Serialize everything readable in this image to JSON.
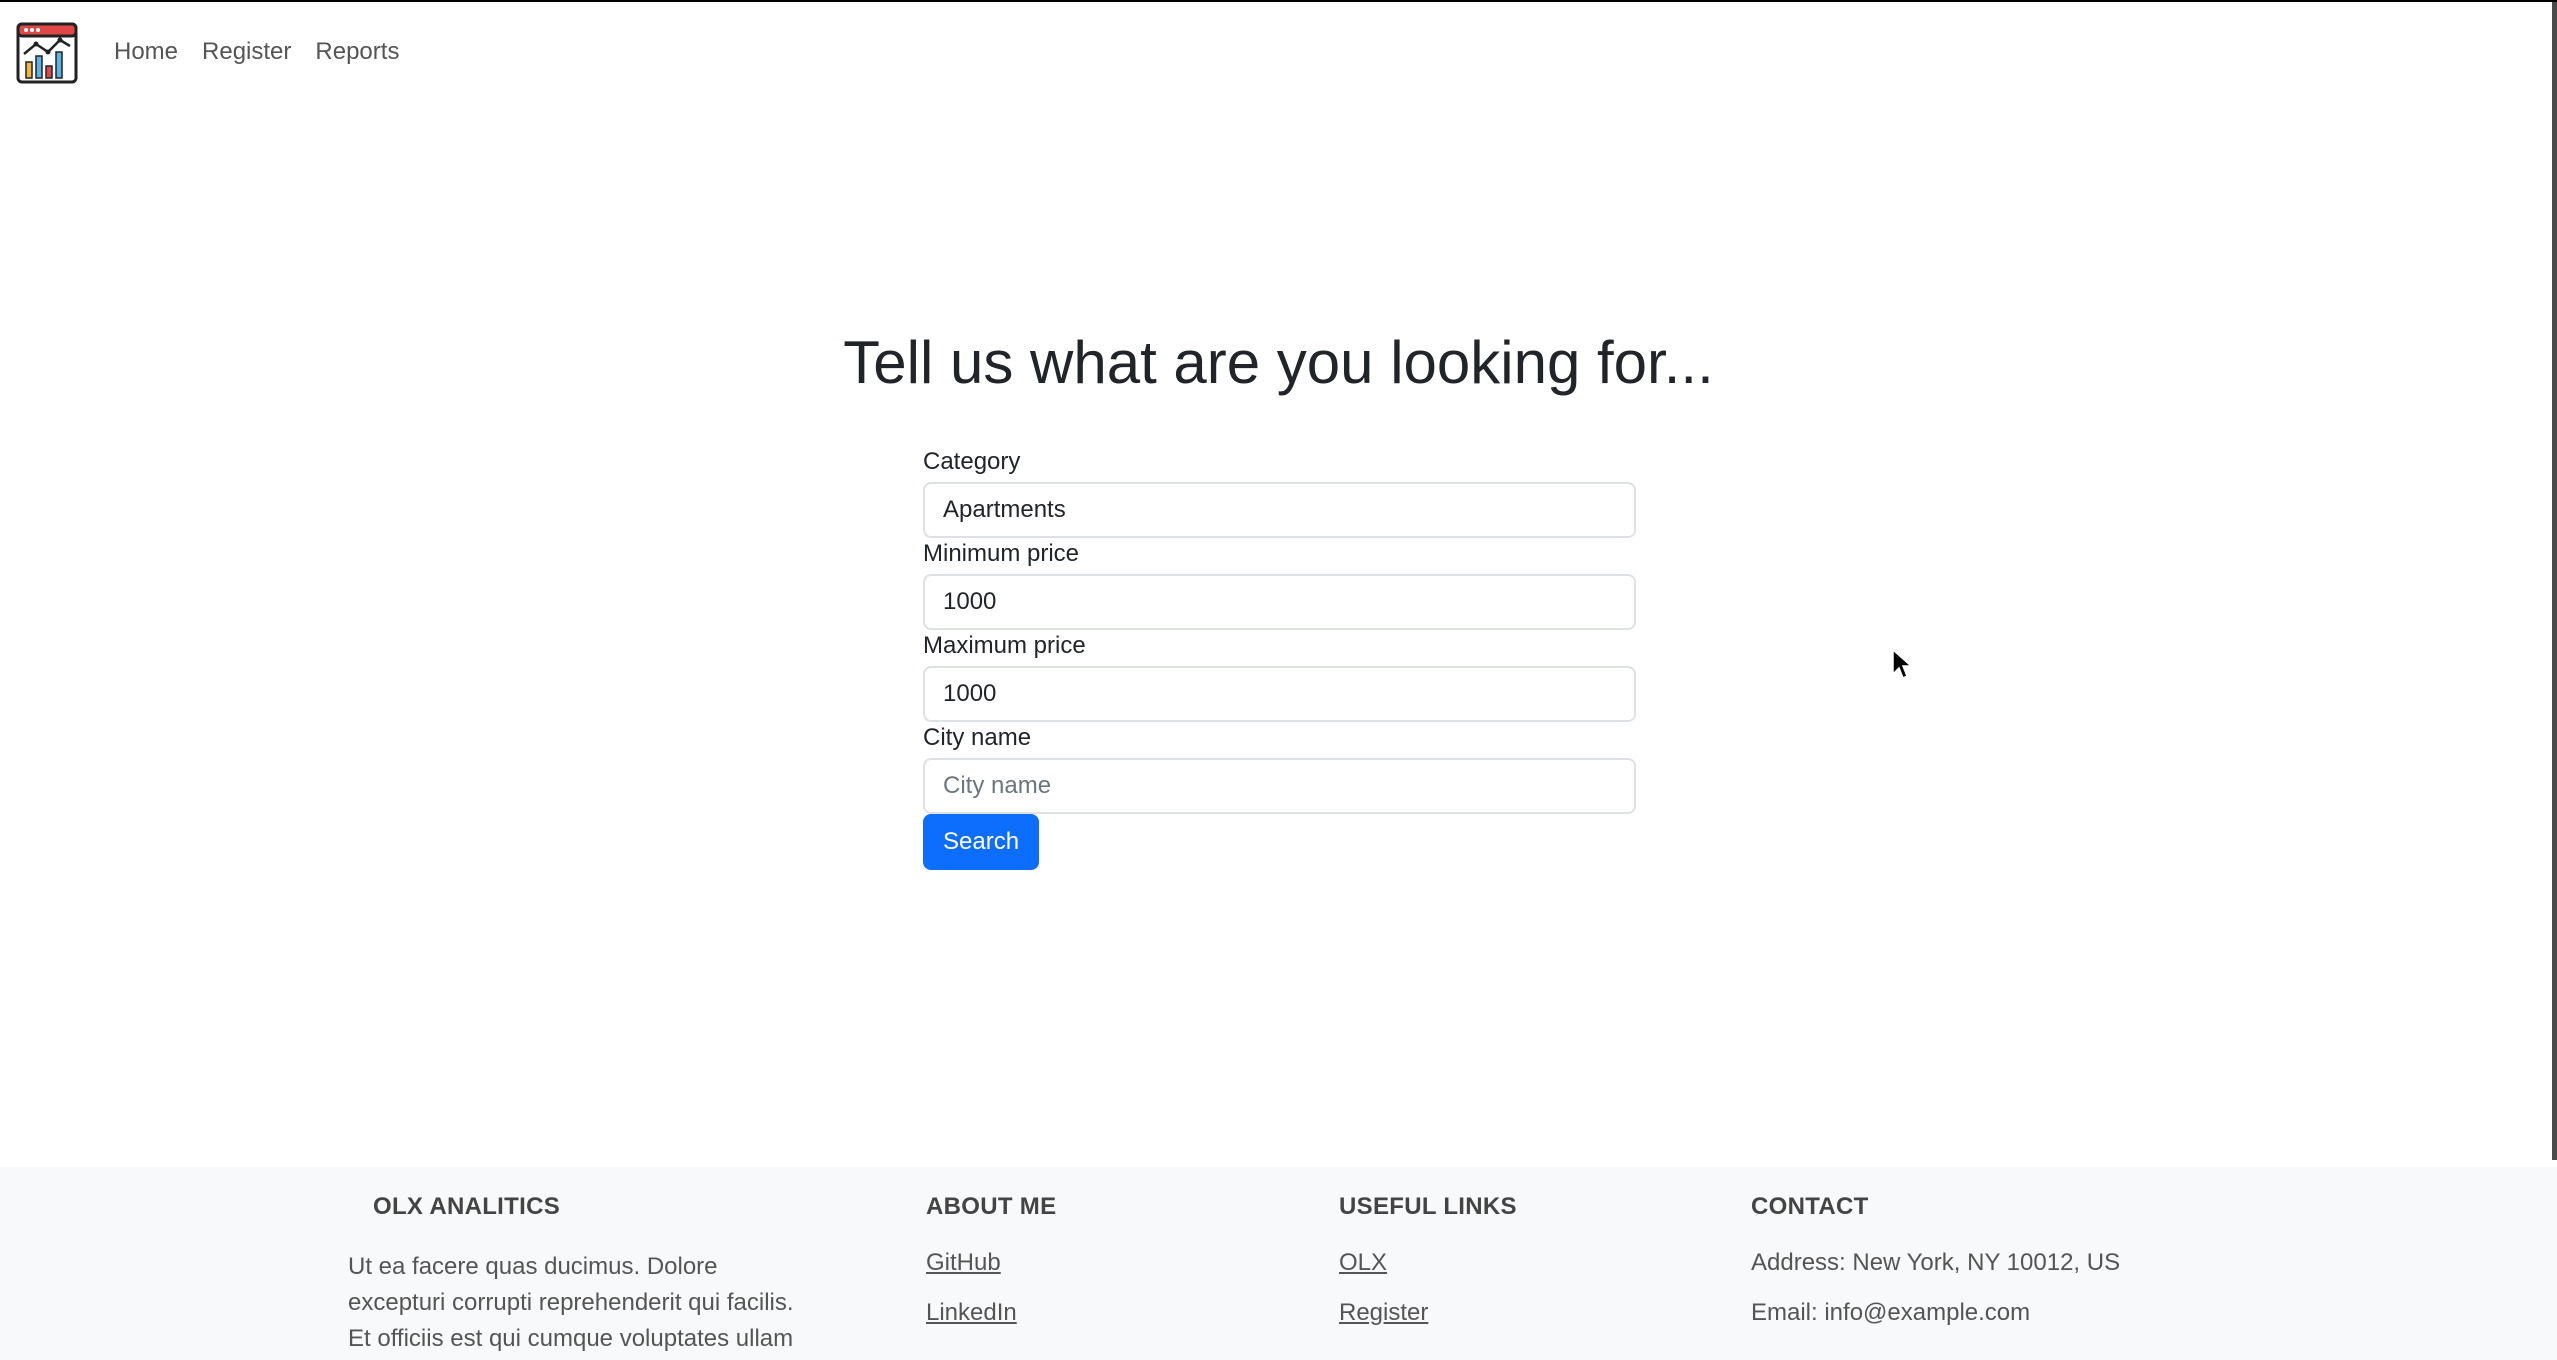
{
  "navbar": {
    "logo_icon": "analytics-chart-logo-icon",
    "links": [
      "Home",
      "Register",
      "Reports"
    ]
  },
  "main": {
    "title": "Tell us what are you looking for...",
    "form": {
      "category": {
        "label": "Category",
        "value": "Apartments",
        "placeholder": ""
      },
      "min_price": {
        "label": "Minimum price",
        "value": "1000",
        "placeholder": ""
      },
      "max_price": {
        "label": "Maximum price",
        "value": "1000",
        "placeholder": ""
      },
      "city": {
        "label": "City name",
        "value": "",
        "placeholder": "City name"
      },
      "search_label": "Search"
    }
  },
  "footer": {
    "brand": {
      "heading": "OLX ANALITICS",
      "text": "Ut ea facere quas ducimus. Dolore excepturi corrupti reprehenderit qui facilis. Et officiis est qui cumque voluptates ullam"
    },
    "about": {
      "heading": "ABOUT ME",
      "links": [
        "GitHub",
        "LinkedIn"
      ]
    },
    "useful": {
      "heading": "USEFUL LINKS",
      "links": [
        "OLX",
        "Register"
      ]
    },
    "contact": {
      "heading": "CONTACT",
      "address": "Address: New York, NY 10012, US",
      "email": "Email: info@example.com"
    }
  },
  "colors": {
    "primary": "#0d6efd",
    "footer_bg": "#f8f9fa",
    "text": "#212529"
  }
}
